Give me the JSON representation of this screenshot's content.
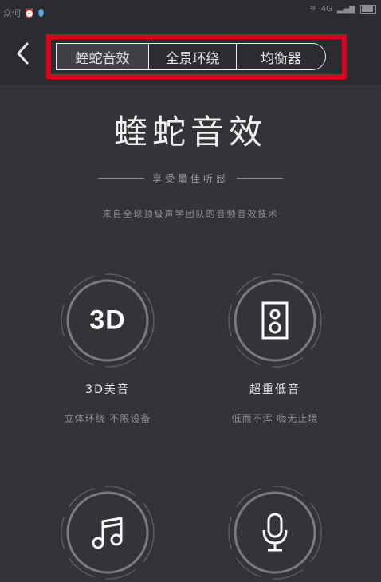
{
  "status_bar": {
    "left_text": "众何",
    "right_text": "4G"
  },
  "header": {
    "tabs": [
      {
        "label": "蝰蛇音效",
        "active": true
      },
      {
        "label": "全景环绕",
        "active": false
      },
      {
        "label": "均衡器",
        "active": false
      }
    ]
  },
  "hero": {
    "title": "蝰蛇音效",
    "subtitle": "享受最佳听感",
    "description": "来自全球顶级声学团队的音频音效技术"
  },
  "features": [
    {
      "icon_label": "3D",
      "name": "3D美音",
      "sub": "立体环绕 不限设备"
    },
    {
      "icon_label": "",
      "name": "超重低音",
      "sub": "低而不浑 嗨无止境"
    },
    {
      "icon_label": "",
      "name": "",
      "sub": ""
    },
    {
      "icon_label": "",
      "name": "",
      "sub": ""
    }
  ],
  "colors": {
    "background": "#333438",
    "header": "#2b2c30",
    "highlight": "#e1001b",
    "text": "#e9e9ea"
  },
  "icons": [
    "back-icon",
    "3d-icon",
    "speaker-icon",
    "music-note-icon",
    "microphone-icon"
  ]
}
